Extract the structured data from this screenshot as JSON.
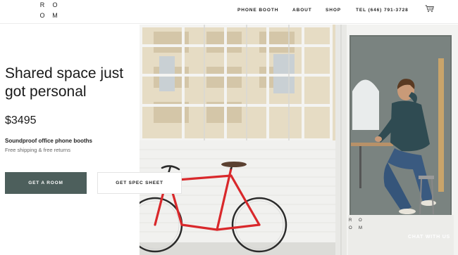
{
  "brand": {
    "logo_letters": [
      "R",
      "O",
      "O",
      "M"
    ]
  },
  "nav": {
    "items": [
      {
        "label": "PHONE BOOTH"
      },
      {
        "label": "ABOUT"
      },
      {
        "label": "SHOP"
      },
      {
        "label": "TEL (646) 791-3728"
      }
    ],
    "cart_icon": "cart-icon"
  },
  "hero": {
    "title": "Shared space just got personal",
    "price": "$3495",
    "subtitle": "Soundproof office phone booths",
    "shipping_note": "Free shipping & free returns",
    "primary_cta": "GET A ROOM",
    "secondary_cta": "GET SPEC SHEET"
  },
  "booth_logo_letters": [
    "R",
    "O",
    "O",
    "M"
  ],
  "chat": {
    "label": "CHAT WITH US"
  },
  "colors": {
    "primary_button": "#4d5f5c",
    "text": "#1a1a1a",
    "muted_text": "#666666"
  }
}
